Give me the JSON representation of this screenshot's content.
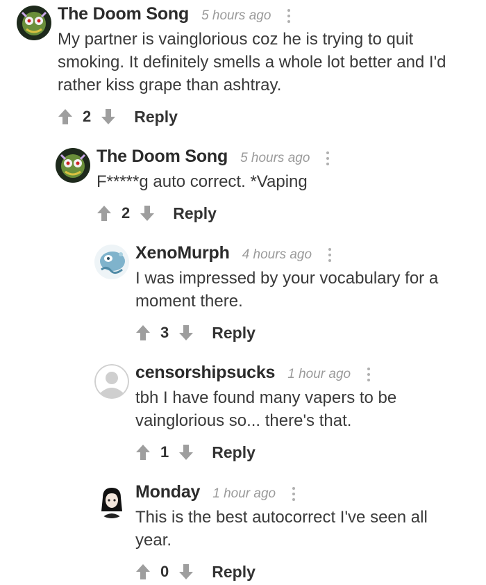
{
  "comments": [
    {
      "author": "The Doom Song",
      "time": "5 hours ago",
      "text": "My partner is vainglorious coz he is trying to quit smoking. It definitely smells a whole lot better and I'd rather kiss grape than ashtray.",
      "votes": "2",
      "reply_label": "Reply",
      "avatar": "doom-avatar"
    },
    {
      "author": "The Doom Song",
      "time": "5 hours ago",
      "text": "F*****g auto correct. *Vaping",
      "votes": "2",
      "reply_label": "Reply",
      "avatar": "doom-avatar"
    },
    {
      "author": "XenoMurph",
      "time": "4 hours ago",
      "text": "I was impressed by your vocabulary for a moment there.",
      "votes": "3",
      "reply_label": "Reply",
      "avatar": "xeno-avatar"
    },
    {
      "author": "censorshipsucks",
      "time": "1 hour ago",
      "text": "tbh I have found many vapers to be vainglorious so... there's that.",
      "votes": "1",
      "reply_label": "Reply",
      "avatar": "default-avatar"
    },
    {
      "author": "Monday",
      "time": "1 hour ago",
      "text": "This is the best autocorrect I've seen all year.",
      "votes": "0",
      "reply_label": "Reply",
      "avatar": "monday-avatar"
    }
  ],
  "colors": {
    "arrow": "#9e9e9e",
    "time": "#9a9a9a",
    "text": "#3a3a3a"
  }
}
